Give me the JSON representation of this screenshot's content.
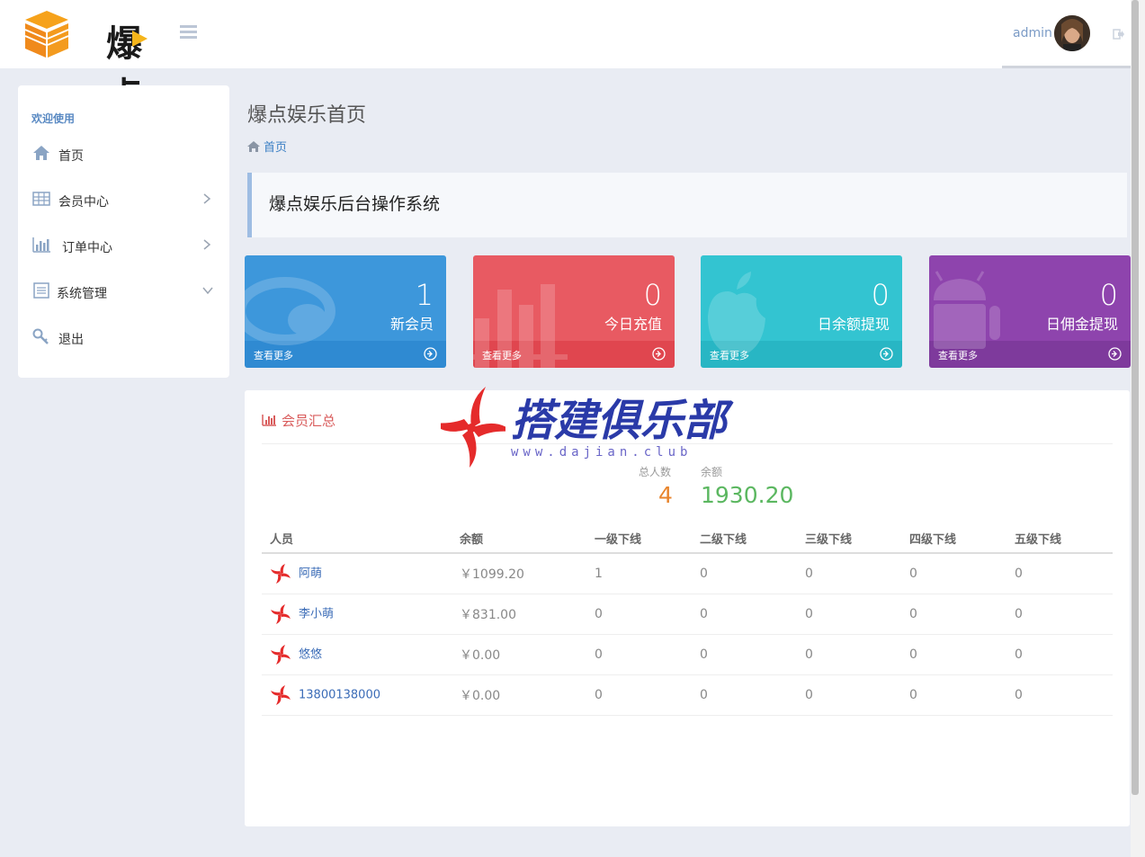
{
  "brand": {
    "logo_text": "爆点"
  },
  "user": {
    "name": "admin"
  },
  "sidebar": {
    "heading": "欢迎使用",
    "items": [
      {
        "label": "首页",
        "icon": "home-icon"
      },
      {
        "label": "会员中心",
        "icon": "table-icon",
        "chevron": "right"
      },
      {
        "label": "订单中心",
        "icon": "bar-chart-icon",
        "chevron": "right"
      },
      {
        "label": "系统管理",
        "icon": "list-icon",
        "chevron": "down"
      },
      {
        "label": "退出",
        "icon": "key-icon"
      }
    ]
  },
  "main": {
    "title": "爆点娱乐首页",
    "breadcrumb": "首页",
    "welcome": "爆点娱乐后台操作系统"
  },
  "stats": [
    {
      "value": "1",
      "label": "新会员",
      "more": "查看更多",
      "color": "#3d97db"
    },
    {
      "value": "0",
      "label": "今日充值",
      "more": "查看更多",
      "color": "#e85a62"
    },
    {
      "value": "0",
      "label": "日余额提现",
      "more": "查看更多",
      "color": "#33c4d1"
    },
    {
      "value": "0",
      "label": "日佣金提现",
      "more": "查看更多",
      "color": "#8e44ad"
    }
  ],
  "summary": {
    "title": "会员汇总",
    "total_label": "总人数",
    "total_value": "4",
    "balance_label": "余额",
    "balance_value": "1930.20"
  },
  "watermark": {
    "text": "搭建俱乐部",
    "url": "www.dajian.club"
  },
  "table": {
    "headers": [
      "人员",
      "余额",
      "一级下线",
      "二级下线",
      "三级下线",
      "四级下线",
      "五级下线"
    ],
    "rows": [
      {
        "name": "阿萌",
        "balance": "￥1099.20",
        "l1": "1",
        "l2": "0",
        "l3": "0",
        "l4": "0",
        "l5": "0"
      },
      {
        "name": "李小萌",
        "balance": "￥831.00",
        "l1": "0",
        "l2": "0",
        "l3": "0",
        "l4": "0",
        "l5": "0"
      },
      {
        "name": "悠悠",
        "balance": "￥0.00",
        "l1": "0",
        "l2": "0",
        "l3": "0",
        "l4": "0",
        "l5": "0"
      },
      {
        "name": "13800138000",
        "balance": "￥0.00",
        "l1": "0",
        "l2": "0",
        "l3": "0",
        "l4": "0",
        "l5": "0"
      }
    ]
  }
}
